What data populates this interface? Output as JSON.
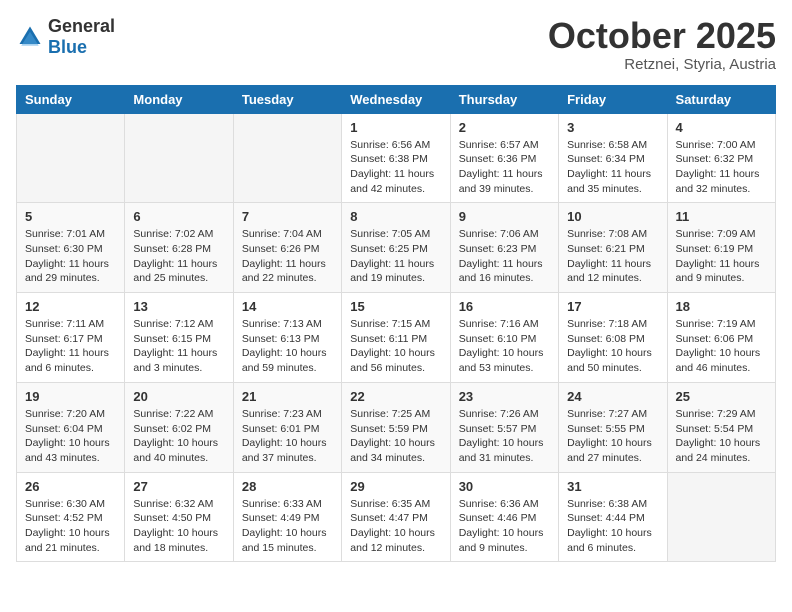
{
  "logo": {
    "general": "General",
    "blue": "Blue"
  },
  "header": {
    "month": "October 2025",
    "location": "Retznei, Styria, Austria"
  },
  "weekdays": [
    "Sunday",
    "Monday",
    "Tuesday",
    "Wednesday",
    "Thursday",
    "Friday",
    "Saturday"
  ],
  "weeks": [
    [
      {
        "day": "",
        "sunrise": "",
        "sunset": "",
        "daylight": ""
      },
      {
        "day": "",
        "sunrise": "",
        "sunset": "",
        "daylight": ""
      },
      {
        "day": "",
        "sunrise": "",
        "sunset": "",
        "daylight": ""
      },
      {
        "day": "1",
        "sunrise": "Sunrise: 6:56 AM",
        "sunset": "Sunset: 6:38 PM",
        "daylight": "Daylight: 11 hours and 42 minutes."
      },
      {
        "day": "2",
        "sunrise": "Sunrise: 6:57 AM",
        "sunset": "Sunset: 6:36 PM",
        "daylight": "Daylight: 11 hours and 39 minutes."
      },
      {
        "day": "3",
        "sunrise": "Sunrise: 6:58 AM",
        "sunset": "Sunset: 6:34 PM",
        "daylight": "Daylight: 11 hours and 35 minutes."
      },
      {
        "day": "4",
        "sunrise": "Sunrise: 7:00 AM",
        "sunset": "Sunset: 6:32 PM",
        "daylight": "Daylight: 11 hours and 32 minutes."
      }
    ],
    [
      {
        "day": "5",
        "sunrise": "Sunrise: 7:01 AM",
        "sunset": "Sunset: 6:30 PM",
        "daylight": "Daylight: 11 hours and 29 minutes."
      },
      {
        "day": "6",
        "sunrise": "Sunrise: 7:02 AM",
        "sunset": "Sunset: 6:28 PM",
        "daylight": "Daylight: 11 hours and 25 minutes."
      },
      {
        "day": "7",
        "sunrise": "Sunrise: 7:04 AM",
        "sunset": "Sunset: 6:26 PM",
        "daylight": "Daylight: 11 hours and 22 minutes."
      },
      {
        "day": "8",
        "sunrise": "Sunrise: 7:05 AM",
        "sunset": "Sunset: 6:25 PM",
        "daylight": "Daylight: 11 hours and 19 minutes."
      },
      {
        "day": "9",
        "sunrise": "Sunrise: 7:06 AM",
        "sunset": "Sunset: 6:23 PM",
        "daylight": "Daylight: 11 hours and 16 minutes."
      },
      {
        "day": "10",
        "sunrise": "Sunrise: 7:08 AM",
        "sunset": "Sunset: 6:21 PM",
        "daylight": "Daylight: 11 hours and 12 minutes."
      },
      {
        "day": "11",
        "sunrise": "Sunrise: 7:09 AM",
        "sunset": "Sunset: 6:19 PM",
        "daylight": "Daylight: 11 hours and 9 minutes."
      }
    ],
    [
      {
        "day": "12",
        "sunrise": "Sunrise: 7:11 AM",
        "sunset": "Sunset: 6:17 PM",
        "daylight": "Daylight: 11 hours and 6 minutes."
      },
      {
        "day": "13",
        "sunrise": "Sunrise: 7:12 AM",
        "sunset": "Sunset: 6:15 PM",
        "daylight": "Daylight: 11 hours and 3 minutes."
      },
      {
        "day": "14",
        "sunrise": "Sunrise: 7:13 AM",
        "sunset": "Sunset: 6:13 PM",
        "daylight": "Daylight: 10 hours and 59 minutes."
      },
      {
        "day": "15",
        "sunrise": "Sunrise: 7:15 AM",
        "sunset": "Sunset: 6:11 PM",
        "daylight": "Daylight: 10 hours and 56 minutes."
      },
      {
        "day": "16",
        "sunrise": "Sunrise: 7:16 AM",
        "sunset": "Sunset: 6:10 PM",
        "daylight": "Daylight: 10 hours and 53 minutes."
      },
      {
        "day": "17",
        "sunrise": "Sunrise: 7:18 AM",
        "sunset": "Sunset: 6:08 PM",
        "daylight": "Daylight: 10 hours and 50 minutes."
      },
      {
        "day": "18",
        "sunrise": "Sunrise: 7:19 AM",
        "sunset": "Sunset: 6:06 PM",
        "daylight": "Daylight: 10 hours and 46 minutes."
      }
    ],
    [
      {
        "day": "19",
        "sunrise": "Sunrise: 7:20 AM",
        "sunset": "Sunset: 6:04 PM",
        "daylight": "Daylight: 10 hours and 43 minutes."
      },
      {
        "day": "20",
        "sunrise": "Sunrise: 7:22 AM",
        "sunset": "Sunset: 6:02 PM",
        "daylight": "Daylight: 10 hours and 40 minutes."
      },
      {
        "day": "21",
        "sunrise": "Sunrise: 7:23 AM",
        "sunset": "Sunset: 6:01 PM",
        "daylight": "Daylight: 10 hours and 37 minutes."
      },
      {
        "day": "22",
        "sunrise": "Sunrise: 7:25 AM",
        "sunset": "Sunset: 5:59 PM",
        "daylight": "Daylight: 10 hours and 34 minutes."
      },
      {
        "day": "23",
        "sunrise": "Sunrise: 7:26 AM",
        "sunset": "Sunset: 5:57 PM",
        "daylight": "Daylight: 10 hours and 31 minutes."
      },
      {
        "day": "24",
        "sunrise": "Sunrise: 7:27 AM",
        "sunset": "Sunset: 5:55 PM",
        "daylight": "Daylight: 10 hours and 27 minutes."
      },
      {
        "day": "25",
        "sunrise": "Sunrise: 7:29 AM",
        "sunset": "Sunset: 5:54 PM",
        "daylight": "Daylight: 10 hours and 24 minutes."
      }
    ],
    [
      {
        "day": "26",
        "sunrise": "Sunrise: 6:30 AM",
        "sunset": "Sunset: 4:52 PM",
        "daylight": "Daylight: 10 hours and 21 minutes."
      },
      {
        "day": "27",
        "sunrise": "Sunrise: 6:32 AM",
        "sunset": "Sunset: 4:50 PM",
        "daylight": "Daylight: 10 hours and 18 minutes."
      },
      {
        "day": "28",
        "sunrise": "Sunrise: 6:33 AM",
        "sunset": "Sunset: 4:49 PM",
        "daylight": "Daylight: 10 hours and 15 minutes."
      },
      {
        "day": "29",
        "sunrise": "Sunrise: 6:35 AM",
        "sunset": "Sunset: 4:47 PM",
        "daylight": "Daylight: 10 hours and 12 minutes."
      },
      {
        "day": "30",
        "sunrise": "Sunrise: 6:36 AM",
        "sunset": "Sunset: 4:46 PM",
        "daylight": "Daylight: 10 hours and 9 minutes."
      },
      {
        "day": "31",
        "sunrise": "Sunrise: 6:38 AM",
        "sunset": "Sunset: 4:44 PM",
        "daylight": "Daylight: 10 hours and 6 minutes."
      },
      {
        "day": "",
        "sunrise": "",
        "sunset": "",
        "daylight": ""
      }
    ]
  ]
}
